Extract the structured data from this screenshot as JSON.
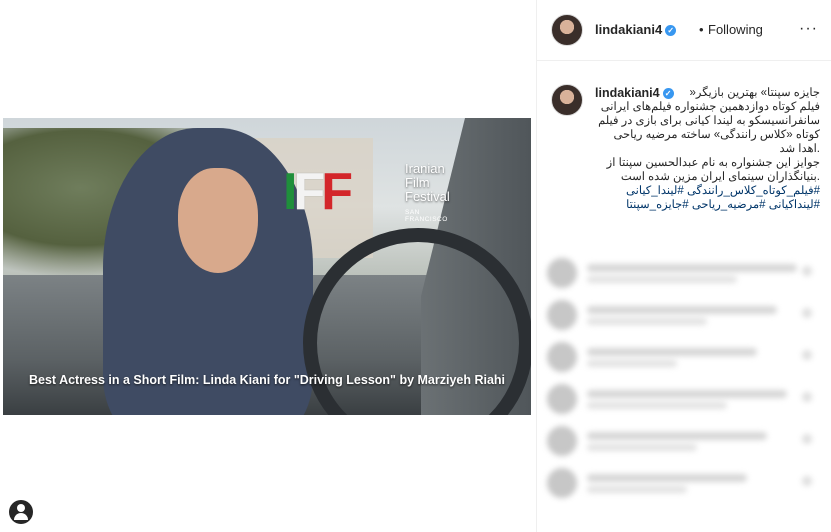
{
  "post": {
    "image_caption": "Best Actress in a Short Film: Linda Kiani for \"Driving Lesson\" by Marziyeh Riahi",
    "festival_logo_text": "Iranian Film Festival",
    "festival_line1": "Iranian",
    "festival_line2": "Film",
    "festival_line3": "Festival",
    "festival_sub": "SAN FRANCISCO"
  },
  "header": {
    "username": "lindakiani4",
    "separator": "•",
    "follow_status": "Following",
    "more_label": "···"
  },
  "caption": {
    "username": "lindakiani4",
    "lines": [
      "جایزه سپنتا» بهترین بازیگر«",
      "فیلم کوتاه دوازدهمین جشنواره فیلم‌های ایرانی",
      "سانفرانسیسکو به لیندا کیانی برای بازی در فیلم",
      "کوتاه «کلاس رانندگی» ساخته مرضیه ریاحی",
      ".اهدا شد",
      "جوایز این جشنواره به نام عبدالحسین سپنتا از",
      ".بنیانگذاران سینمای ایران مزین شده است"
    ],
    "hashtags_1": "#فیلم_کوتاه_کلاس_رانندگی #لیندا_کیانی",
    "hashtags_2": "#لینداکیانی #مرضیه_ریاحی #جایزه_سپنتا"
  },
  "icons": {
    "verified": "verified-badge-icon",
    "profile": "profile-icon"
  }
}
